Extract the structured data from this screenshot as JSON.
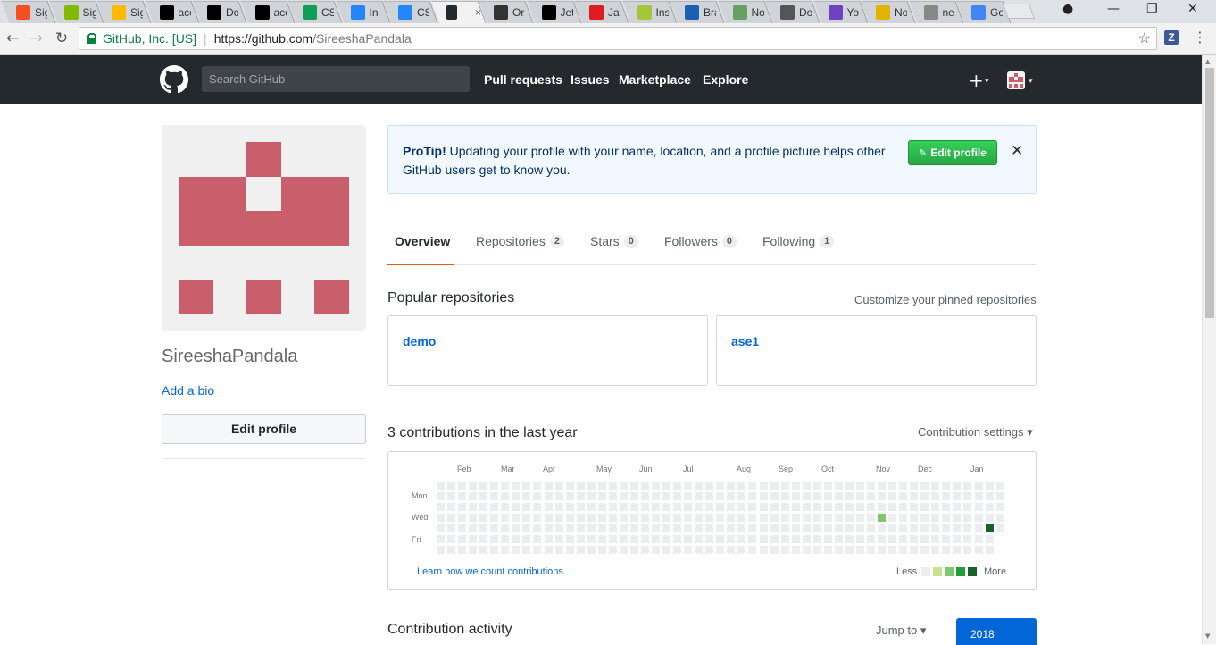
{
  "browser": {
    "tabs": [
      {
        "label": "Sig",
        "icon": "windows-logo-icon",
        "color": "#f25022"
      },
      {
        "label": "Sig",
        "icon": "windows-logo-icon",
        "color": "#7fba00"
      },
      {
        "label": "Sig",
        "icon": "windows-logo-icon",
        "color": "#ffb900"
      },
      {
        "label": "acc",
        "icon": "jetbrains-icon",
        "color": "#000000"
      },
      {
        "label": "Do",
        "icon": "jetbrains-icon",
        "color": "#000000"
      },
      {
        "label": "acc",
        "icon": "jetbrains-icon",
        "color": "#000000"
      },
      {
        "label": "CS",
        "icon": "sheets-icon",
        "color": "#0f9d58"
      },
      {
        "label": "In",
        "icon": "box-icon",
        "color": "#2486fc"
      },
      {
        "label": "CS",
        "icon": "box-icon",
        "color": "#2486fc"
      },
      {
        "label": "",
        "icon": "github-icon",
        "color": "#24292e"
      },
      {
        "label": "Or",
        "icon": "bulb-icon",
        "color": "#333333"
      },
      {
        "label": "Jet",
        "icon": "jetbrains-icon",
        "color": "#000000"
      },
      {
        "label": "Jav",
        "icon": "oracle-icon",
        "color": "#e11b22"
      },
      {
        "label": "Ins",
        "icon": "android-icon",
        "color": "#a4c639"
      },
      {
        "label": "Bra",
        "icon": "square-icon",
        "color": "#1a5fb4"
      },
      {
        "label": "No",
        "icon": "node-icon",
        "color": "#68a063"
      },
      {
        "label": "Do",
        "icon": "download-icon",
        "color": "#555555"
      },
      {
        "label": "Yo",
        "icon": "list-icon",
        "color": "#6f42c1"
      },
      {
        "label": "No",
        "icon": "notepad-icon",
        "color": "#e0b400"
      },
      {
        "label": "ne",
        "icon": "page-icon",
        "color": "#888888"
      },
      {
        "label": "Go",
        "icon": "drive-icon",
        "color": "#4285f4"
      }
    ],
    "tab_close": "×",
    "secure_label": "GitHub, Inc. [US]",
    "url_scheme_host": "https://github.com",
    "url_path": "/SireeshaPandala",
    "extension_letter": "Z"
  },
  "header": {
    "search_placeholder": "Search GitHub",
    "nav": [
      "Pull requests",
      "Issues",
      "Marketplace",
      "Explore"
    ],
    "plus": "+",
    "caret": "▾"
  },
  "profile": {
    "username": "SireeshaPandala",
    "add_bio": "Add a bio",
    "edit_profile": "Edit profile",
    "identicon_color": "#c85f6b"
  },
  "protip": {
    "lead": "ProTip!",
    "text": " Updating your profile with your name, location, and a profile picture helps other GitHub users get to know you.",
    "button": "Edit profile",
    "close": "✕"
  },
  "tabs": [
    {
      "label": "Overview",
      "count": null
    },
    {
      "label": "Repositories",
      "count": "2"
    },
    {
      "label": "Stars",
      "count": "0"
    },
    {
      "label": "Followers",
      "count": "0"
    },
    {
      "label": "Following",
      "count": "1"
    }
  ],
  "popular": {
    "title": "Popular repositories",
    "customize": "Customize your pinned repositories",
    "repos": [
      "demo",
      "ase1"
    ]
  },
  "contributions": {
    "title": "3 contributions in the last year",
    "settings": "Contribution settings ▾",
    "months": [
      "Feb",
      "Mar",
      "Apr",
      "May",
      "Jun",
      "Jul",
      "Aug",
      "Sep",
      "Oct",
      "Nov",
      "Dec",
      "Jan"
    ],
    "days": [
      "Mon",
      "Wed",
      "Fri"
    ],
    "learn": "Learn how we count contributions.",
    "less": "Less",
    "more": "More",
    "colors": [
      "#ebedf0",
      "#c6e48b",
      "#7bc96f",
      "#239a3b",
      "#196127"
    ]
  },
  "activity": {
    "title": "Contribution activity",
    "jump_to": "Jump to ▾",
    "year": "2018"
  }
}
